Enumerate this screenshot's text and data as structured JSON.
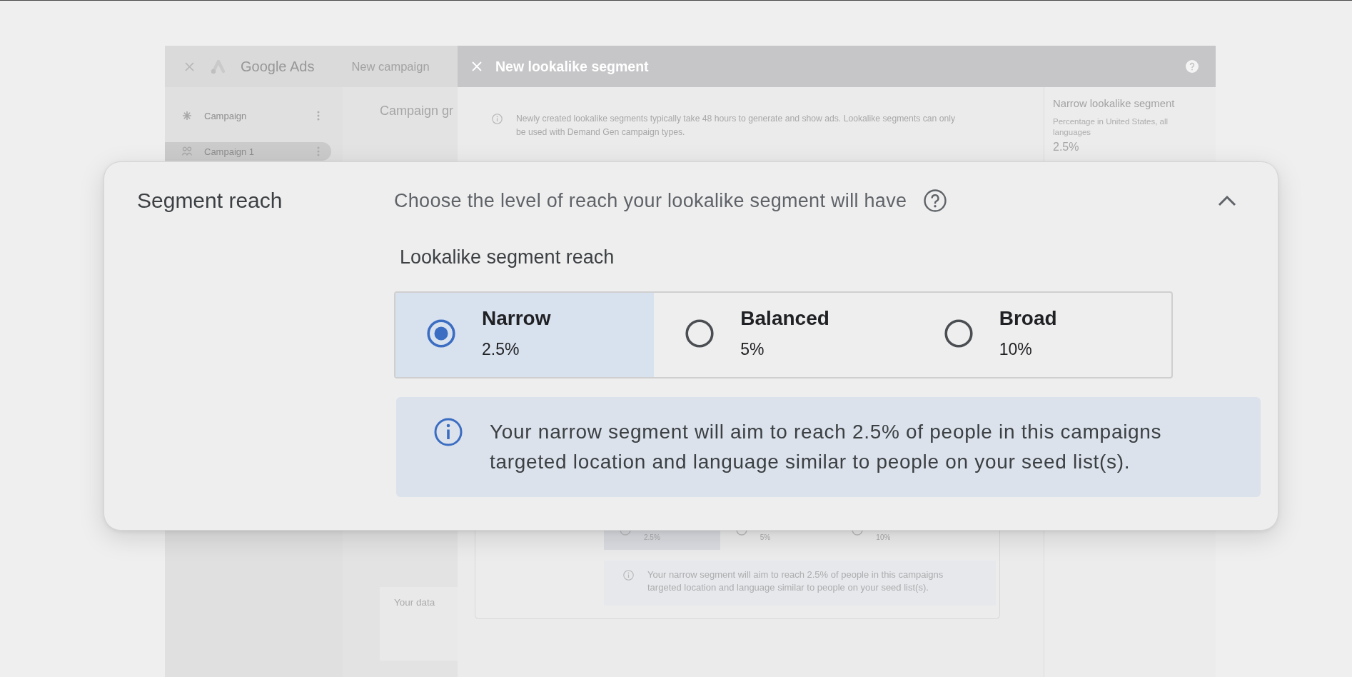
{
  "app_header": {
    "product_name": "Google Ads",
    "page_title": "New campaign"
  },
  "sidebar": {
    "items": [
      {
        "kind": "star",
        "label": "Campaign",
        "selected": false
      },
      {
        "kind": "group",
        "label": "Campaign 1",
        "selected": true
      }
    ]
  },
  "main_column": {
    "heading": "Campaign gr",
    "section_label": "Your data"
  },
  "dialog": {
    "title": "New lookalike segment",
    "notice": "Newly created lookalike segments typically take 48 hours to generate and show ads. Lookalike segments can only be used with Demand Gen campaign types.",
    "summary": {
      "title": "Narrow lookalike segment",
      "subtitle": "Percentage in United States, all languages",
      "value": "2.5%"
    },
    "reach_options": [
      {
        "value": "2.5%",
        "selected": true
      },
      {
        "value": "5%",
        "selected": false
      },
      {
        "value": "10%",
        "selected": false
      }
    ],
    "reach_info": "Your narrow segment will aim to reach 2.5% of people in this campaigns targeted location and language similar to people on your seed list(s)."
  },
  "segment_reach_card": {
    "title": "Segment reach",
    "description": "Choose the level of reach your lookalike segment will have",
    "expanded": true,
    "field_label": "Lookalike segment reach",
    "options": [
      {
        "label": "Narrow",
        "value": "2.5%",
        "selected": true
      },
      {
        "label": "Balanced",
        "value": "5%",
        "selected": false
      },
      {
        "label": "Broad",
        "value": "10%",
        "selected": false
      }
    ],
    "info": "Your narrow segment will aim to reach 2.5% of people in this campaigns targeted location and language similar to people on your seed list(s)."
  }
}
